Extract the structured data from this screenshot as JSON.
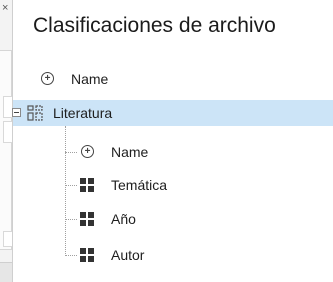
{
  "panel": {
    "title": "Clasificaciones de archivo"
  },
  "left_panel": {
    "close_glyph": "×"
  },
  "tree": {
    "root_add": {
      "label": "Name",
      "icon": "add-circle-icon"
    },
    "group": {
      "label": "Literatura",
      "icon": "classification-group-icon",
      "expanded": true,
      "selected": true,
      "children": [
        {
          "label": "Name",
          "icon": "add-circle-icon"
        },
        {
          "label": "Temática",
          "icon": "property-grid-icon"
        },
        {
          "label": "Año",
          "icon": "property-grid-icon"
        },
        {
          "label": "Autor",
          "icon": "property-grid-icon"
        }
      ]
    }
  },
  "colors": {
    "selection": "#cce4f7",
    "text": "#1e1e1e"
  }
}
